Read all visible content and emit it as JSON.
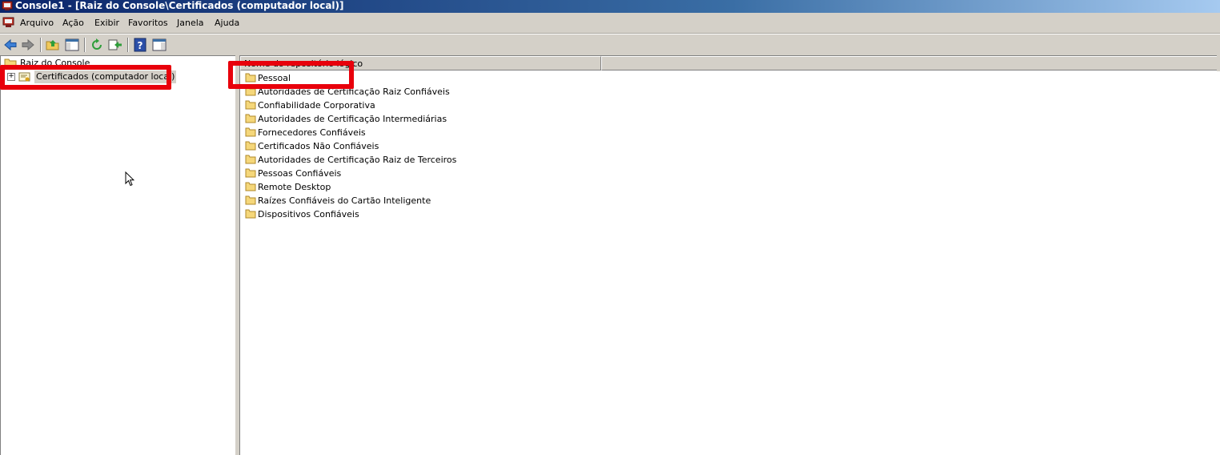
{
  "window": {
    "title": "Console1 - [Raiz do Console\\Certificados (computador local)]",
    "app_icon": "mmc-console-icon"
  },
  "menubar": {
    "items": [
      "Arquivo",
      "Ação",
      "Exibir",
      "Favoritos",
      "Janela",
      "Ajuda"
    ]
  },
  "toolbar": {
    "buttons": [
      "back-arrow-icon",
      "forward-arrow-icon",
      "up-folder-icon",
      "show-hide-tree-icon",
      "refresh-icon",
      "export-list-icon",
      "help-icon",
      "show-hide-action-pane-icon"
    ]
  },
  "tree": {
    "root_label": "Raiz do Console",
    "child_label": "Certificados (computador local)",
    "child_expander": "+"
  },
  "list": {
    "column_header": "Nome do repositório lógico",
    "items": [
      "Pessoal",
      "Autoridades de Certificação Raiz Confiáveis",
      "Confiabilidade Corporativa",
      "Autoridades de Certificação Intermediárias",
      "Fornecedores Confiáveis",
      "Certificados Não Confiáveis",
      "Autoridades de Certificação Raiz de Terceiros",
      "Pessoas Confiáveis",
      "Remote Desktop",
      "Raízes Confiáveis do Cartão Inteligente",
      "Dispositivos Confiáveis"
    ]
  },
  "colors": {
    "highlight": "#e8000b",
    "folder": "#f5d77a",
    "title_bar": "#0a246a"
  }
}
